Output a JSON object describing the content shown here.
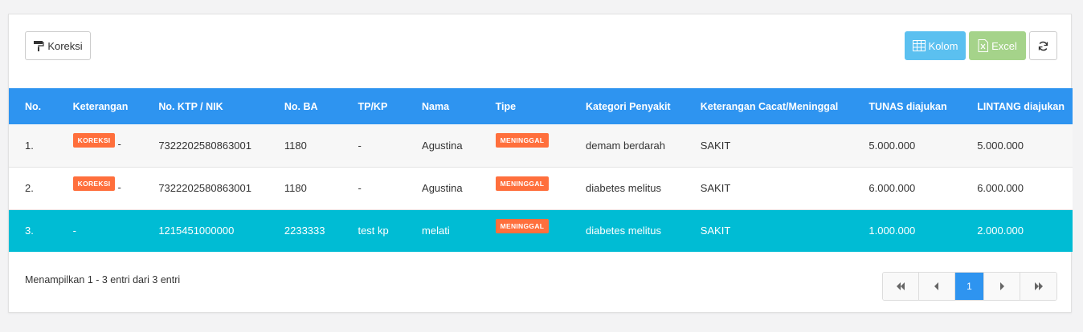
{
  "toolbar": {
    "koreksi_label": "Koreksi",
    "kolom_label": "Kolom",
    "excel_label": "Excel"
  },
  "table": {
    "headers": [
      "No.",
      "Keterangan",
      "No. KTP / NIK",
      "No. BA",
      "TP/KP",
      "Nama",
      "Tipe",
      "Kategori Penyakit",
      "Keterangan Cacat/Meninggal",
      "TUNAS diajukan",
      "LINTANG diajukan"
    ],
    "rows": [
      {
        "no": "1.",
        "badge": "KOREKSI",
        "keterangan": "-",
        "nik": "7322202580863001",
        "ba": "1180",
        "tpkp": "-",
        "nama": "Agustina",
        "tipe": "MENINGGAL",
        "kategori": "demam berdarah",
        "ket_cacat": "SAKIT",
        "tunas": "5.000.000",
        "lintang": "5.000.000"
      },
      {
        "no": "2.",
        "badge": "KOREKSI",
        "keterangan": "-",
        "nik": "7322202580863001",
        "ba": "1180",
        "tpkp": "-",
        "nama": "Agustina",
        "tipe": "MENINGGAL",
        "kategori": "diabetes melitus",
        "ket_cacat": "SAKIT",
        "tunas": "6.000.000",
        "lintang": "6.000.000"
      },
      {
        "no": "3.",
        "keterangan": "-",
        "nik": "1215451000000",
        "ba": "2233333",
        "tpkp": "test kp",
        "nama": "melati",
        "tipe": "MENINGGAL",
        "kategori": "diabetes melitus",
        "ket_cacat": "SAKIT",
        "tunas": "1.000.000",
        "lintang": "2.000.000"
      }
    ]
  },
  "footer": {
    "info": "Menampilkan 1 - 3 entri dari 3 entri",
    "current_page": "1"
  },
  "colors": {
    "header_bg": "#2e94f0",
    "selected_row": "#00bcd4",
    "badge": "#ff6f3c",
    "kolom_button": "#5bc0f0",
    "excel_button": "#a5d38a"
  },
  "icons": {
    "koreksi": "paint-roller-icon",
    "kolom": "table-icon",
    "excel": "excel-file-icon",
    "refresh": "refresh-icon",
    "first": "double-chevron-left-icon",
    "prev": "chevron-left-icon",
    "next": "chevron-right-icon",
    "last": "double-chevron-right-icon"
  }
}
